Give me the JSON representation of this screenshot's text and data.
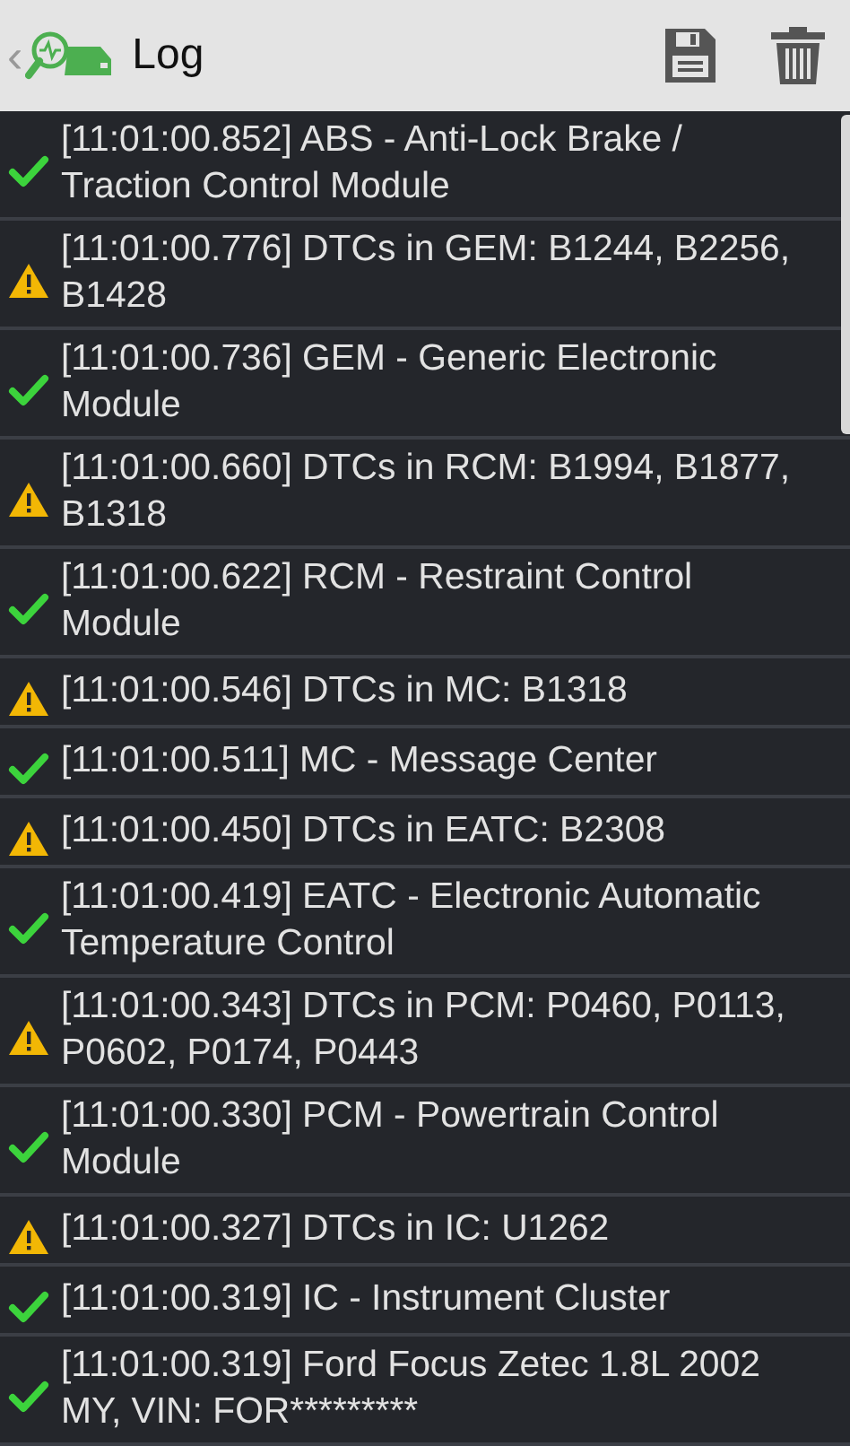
{
  "header": {
    "back": "‹",
    "title": "Log"
  },
  "entries": [
    {
      "kind": "ok",
      "text": "[11:01:00.852] ABS - Anti-Lock Brake / Traction Control Module"
    },
    {
      "kind": "warning",
      "text": "[11:01:00.776] DTCs in GEM: B1244, B2256, B1428"
    },
    {
      "kind": "ok",
      "text": "[11:01:00.736] GEM - Generic Electronic Module"
    },
    {
      "kind": "warning",
      "text": "[11:01:00.660] DTCs in RCM: B1994, B1877, B1318"
    },
    {
      "kind": "ok",
      "text": "[11:01:00.622] RCM - Restraint Control Module"
    },
    {
      "kind": "warning",
      "text": "[11:01:00.546] DTCs in MC: B1318"
    },
    {
      "kind": "ok",
      "text": "[11:01:00.511] MC - Message Center"
    },
    {
      "kind": "warning",
      "text": "[11:01:00.450] DTCs in EATC: B2308"
    },
    {
      "kind": "ok",
      "text": "[11:01:00.419] EATC - Electronic Automatic Temperature Control"
    },
    {
      "kind": "warning",
      "text": "[11:01:00.343] DTCs in PCM: P0460, P0113, P0602, P0174, P0443"
    },
    {
      "kind": "ok",
      "text": "[11:01:00.330] PCM - Powertrain Control Module"
    },
    {
      "kind": "warning",
      "text": "[11:01:00.327] DTCs in IC: U1262"
    },
    {
      "kind": "ok",
      "text": "[11:01:00.319] IC - Instrument Cluster"
    },
    {
      "kind": "ok",
      "text": "[11:01:00.319] Ford Focus Zetec 1.8L 2002 MY, VIN: FOR*********"
    }
  ]
}
